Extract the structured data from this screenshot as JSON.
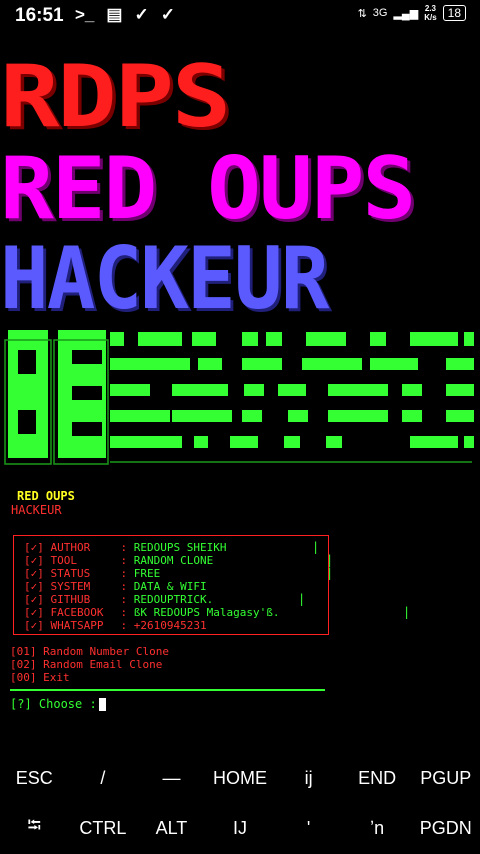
{
  "status_bar": {
    "time": "16:51",
    "network": "3G",
    "speed_top": "2.3",
    "speed_bottom": "K/s",
    "battery": "18"
  },
  "banner": {
    "line1": "RDPS",
    "line2": "RED OUPS",
    "line3": "HACKEUR"
  },
  "tagline": {
    "line1": "RED OUPS",
    "line2": "HACKEUR"
  },
  "info": [
    {
      "check": "[✓]",
      "key": "AUTHOR",
      "value": "REDOUPS SHEIKH"
    },
    {
      "check": "[✓]",
      "key": "TOOL",
      "value": "RANDOM CLONE"
    },
    {
      "check": "[✓]",
      "key": "STATUS",
      "value": "FREE"
    },
    {
      "check": "[✓]",
      "key": "SYSTEM",
      "value": "DATA & WIFI"
    },
    {
      "check": "[✓]",
      "key": "GITHUB",
      "value": "REDOUPTRICK."
    },
    {
      "check": "[✓]",
      "key": "FACEBOOK",
      "value": "ßK REDOUPS Malagasy'ß."
    },
    {
      "check": "[✓]",
      "key": "WHATSAPP",
      "value": "+2610945231"
    }
  ],
  "info_sep": ":",
  "menu": [
    "[01] Random Number Clone",
    "[02] Random Email Clone",
    "[00] Exit"
  ],
  "prompt": "[?] Choose :",
  "extra_keys_row1": [
    "ESC",
    "/",
    "—",
    "HOME",
    "ij",
    "END",
    "PGUP"
  ],
  "extra_keys_row2": [
    "⭾",
    "CTRL",
    "ALT",
    "IJ",
    "ʹ",
    "ʼn",
    "PGDN"
  ]
}
